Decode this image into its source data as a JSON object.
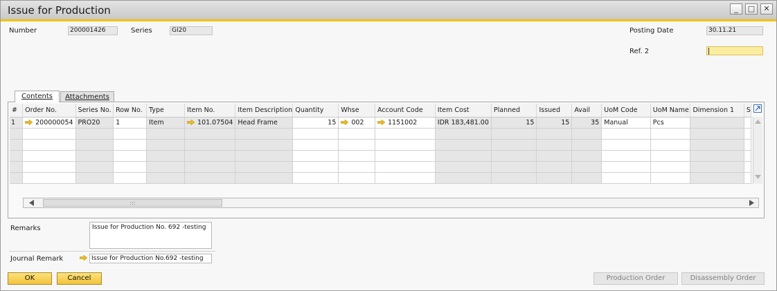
{
  "window": {
    "title": "Issue for Production",
    "minimize": "_",
    "maximize": "□",
    "close": "✕"
  },
  "header": {
    "number_label": "Number",
    "number_value": "200001426",
    "series_label": "Series",
    "series_value": "GI20",
    "posting_date_label": "Posting Date",
    "posting_date_value": "30.11.21",
    "ref2_label": "Ref. 2",
    "ref2_value": ""
  },
  "tabs": [
    {
      "label": "Contents"
    },
    {
      "label": "Attachments"
    }
  ],
  "table": {
    "columns": [
      "#",
      "Order No.",
      "Series No.",
      "Row No.",
      "Type",
      "Item No.",
      "Item Description",
      "Quantity",
      "Whse",
      "Account Code",
      "Item Cost",
      "Planned",
      "Issued",
      "Avail",
      "UoM Code",
      "UoM Name",
      "Dimension 1",
      "S"
    ],
    "rows": [
      {
        "num": "1",
        "order_no": "200000054",
        "series_no": "PRO20",
        "row_no": "1",
        "type": "Item",
        "item_no": "101.07504",
        "item_description": "Head Frame",
        "quantity": "15",
        "whse": "002",
        "account_code": "1151002",
        "item_cost": "IDR 183,481.00",
        "planned": "15",
        "issued": "15",
        "avail": "35",
        "uom_code": "Manual",
        "uom_name": "Pcs",
        "dimension1": "",
        "s": ""
      }
    ]
  },
  "footer": {
    "remarks_label": "Remarks",
    "remarks_value": "Issue for Production No. 692 -testing",
    "journal_remark_label": "Journal Remark",
    "journal_remark_value": "Issue for Production No.692 -testing"
  },
  "buttons": {
    "ok": "OK",
    "cancel": "Cancel",
    "production_order": "Production Order",
    "disassembly_order": "Disassembly Order"
  },
  "icons": {
    "link_arrow": "link-arrow-icon",
    "expand": "expand-table-icon",
    "scroll_grip": ":::"
  },
  "colors": {
    "accent": "#f2c200",
    "button_yellow": "#f7d35a",
    "ref_field": "#fbeda0",
    "link_arrow": "#e8b91c"
  }
}
